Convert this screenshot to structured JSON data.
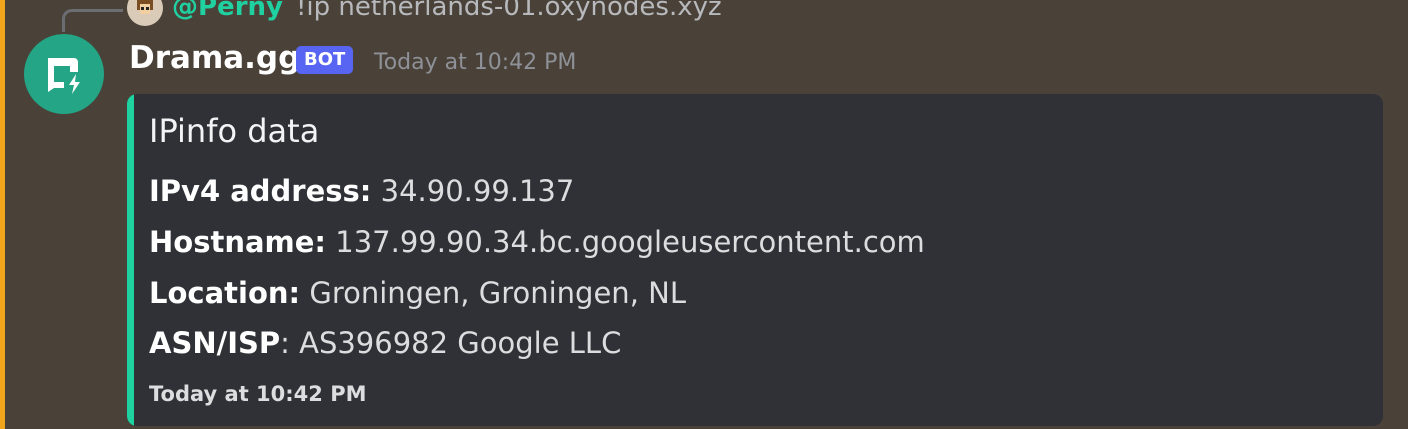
{
  "reply": {
    "mention": "@Perny",
    "text": "!ip netherlands-01.oxynodes.xyz"
  },
  "message": {
    "author": "Drama.gg",
    "badge": "BOT",
    "timestamp": "Today at 10:42 PM",
    "avatar_icon": "chat-bolt-icon"
  },
  "embed": {
    "accent_color": "#1ed39f",
    "title": "IPinfo data",
    "fields": [
      {
        "label": "IPv4 address:",
        "value": " 34.90.99.137"
      },
      {
        "label": "Hostname:",
        "value": " 137.99.90.34.bc.googleusercontent.com"
      },
      {
        "label": "Location:",
        "value": " Groningen, Groningen, NL"
      },
      {
        "label": "ASN/ISP",
        "value": ": AS396982 Google LLC"
      }
    ],
    "footer": "Today at 10:42 PM"
  },
  "colors": {
    "mention_highlight": "#f0a51c",
    "bot_badge": "#5865f2",
    "avatar_bg": "#23a586"
  }
}
